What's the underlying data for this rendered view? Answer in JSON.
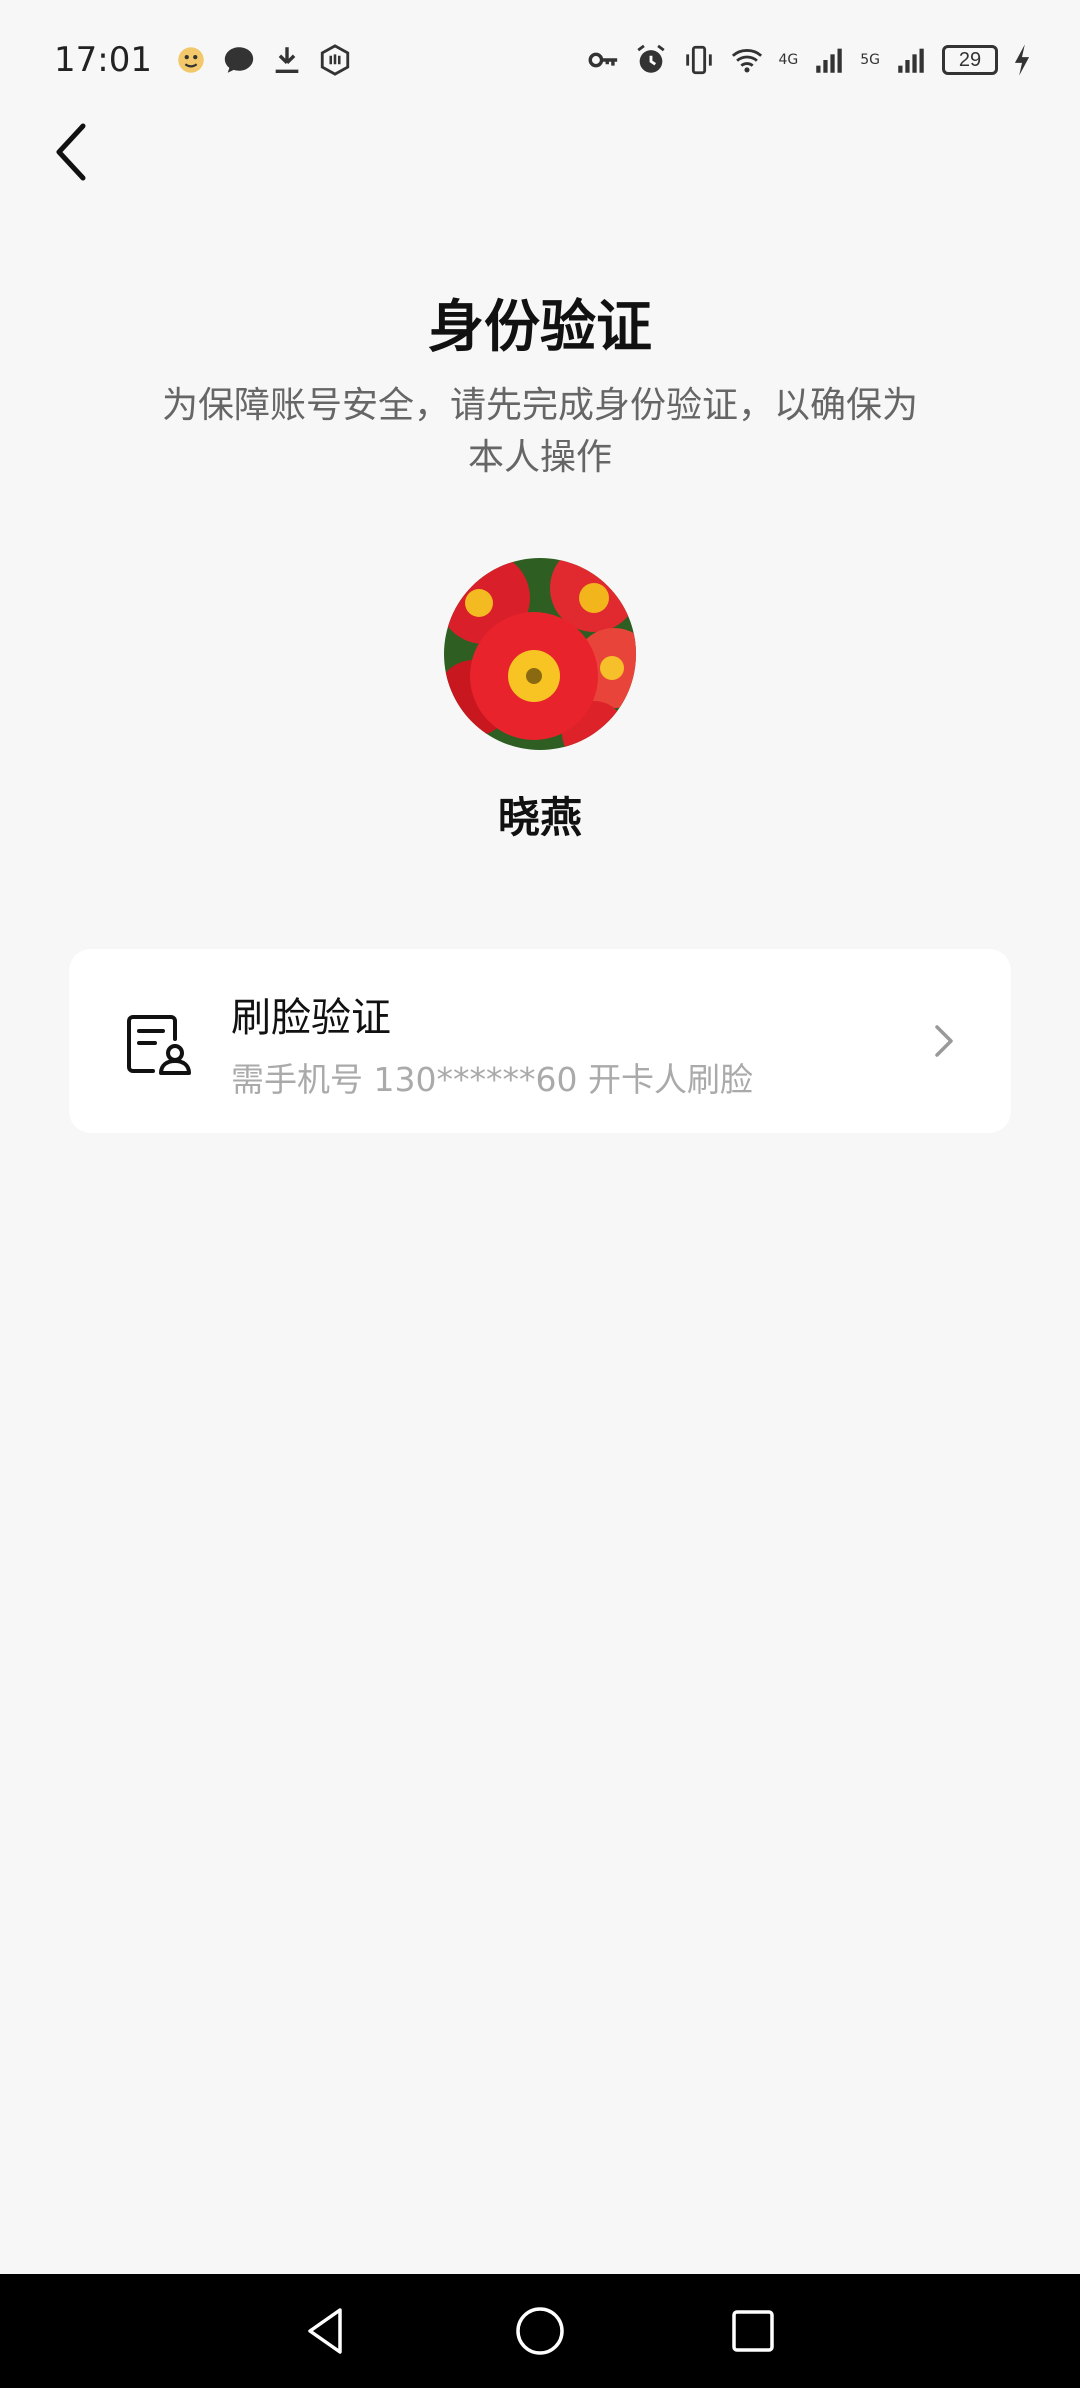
{
  "status_bar": {
    "time": "17:01",
    "network_1": "4G",
    "network_2": "5G",
    "battery": "29",
    "left_icons": [
      "emoji-icon",
      "chat-bubble-icon",
      "download-icon",
      "hand-icon"
    ],
    "right_icons": [
      "key-icon",
      "alarm-icon",
      "vibrate-icon",
      "wifi-icon",
      "signal-icon",
      "signal-icon",
      "battery-icon",
      "charging-icon"
    ]
  },
  "header": {
    "title": "身份验证",
    "subtitle": "为保障账号安全，请先完成身份验证，以确保为本人操作"
  },
  "profile": {
    "name": "晓燕"
  },
  "verification_options": [
    {
      "icon": "face-id-document-icon",
      "title": "刷脸验证",
      "description": "需手机号 130******60 开卡人刷脸"
    }
  ],
  "nav_bar": {
    "buttons": [
      "back-triangle-icon",
      "home-circle-icon",
      "recents-square-icon"
    ]
  },
  "colors": {
    "background": "#f7f7f7",
    "card": "#ffffff",
    "subtitle": "#666666",
    "description": "#aaaaaa",
    "nav": "#000000"
  }
}
